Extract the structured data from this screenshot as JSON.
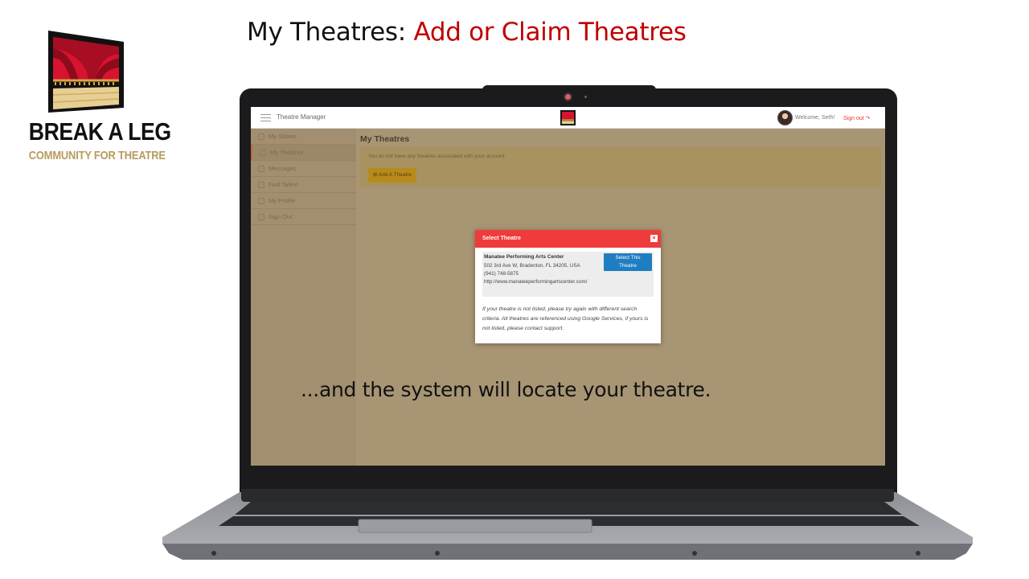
{
  "slide": {
    "title_prefix": "My Theatres:",
    "title_accent": "Add or Claim Theatres",
    "caption": "...and the system will locate your theatre."
  },
  "logo": {
    "line1": "BREAK A LEG",
    "line2": "COMMUNITY FOR THEATRE"
  },
  "app": {
    "title": "Theatre Manager",
    "welcome": "Welcome, Seth!",
    "signout": "Sign out"
  },
  "sidebar": {
    "items": [
      {
        "label": "My Shows",
        "icon": "shows-icon"
      },
      {
        "label": "My Theatres",
        "icon": "theatre-icon"
      },
      {
        "label": "Messages",
        "icon": "messages-icon"
      },
      {
        "label": "Find Talent",
        "icon": "user-icon"
      },
      {
        "label": "My Profile",
        "icon": "profile-icon"
      },
      {
        "label": "Sign Out",
        "icon": "signout-icon"
      }
    ]
  },
  "main": {
    "title": "My Theatres",
    "alert": "You do not have any theatres associated with your account.",
    "add_button": "Add A Theatre"
  },
  "modal": {
    "title": "Select Theatre",
    "close": "×",
    "result": {
      "name": "Manatee Performing Arts Center",
      "address": "502 3rd Ave W, Bradenton, FL 34205, USA",
      "phone": "(941) 748-5875",
      "url": "http://www.manateeperformingartscenter.com/",
      "button_line1": "Select This",
      "button_line2": "Theatre"
    },
    "note": "If your theatre is not listed, please try again with different search criteria. All theatres are referenced using Google Services, if yours is not listed, please contact support."
  },
  "colors": {
    "accent": "#c00000",
    "modal_header": "#ef3b3b",
    "select_button": "#1f7dc1",
    "signout": "#e23a3a"
  }
}
